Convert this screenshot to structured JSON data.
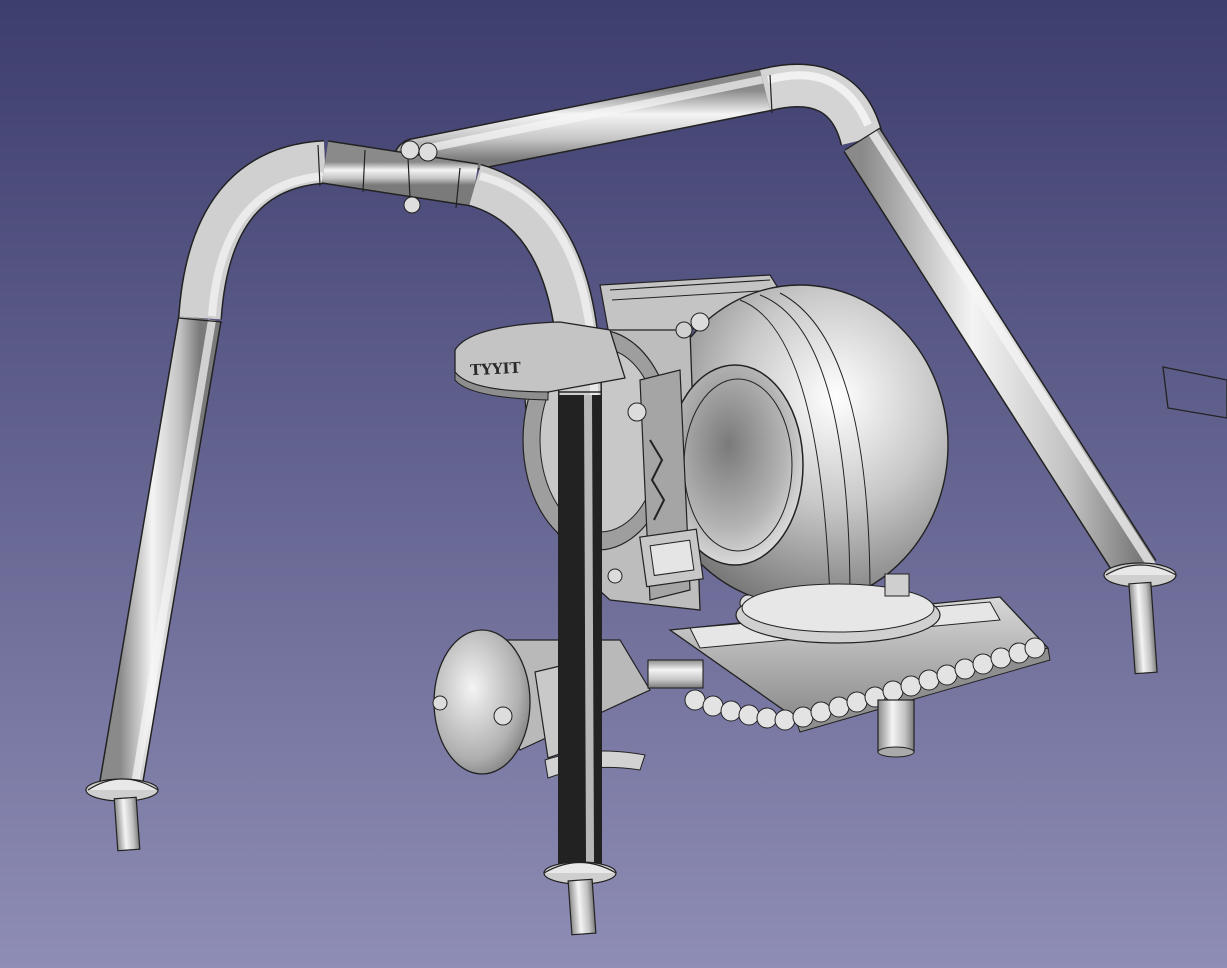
{
  "app": {
    "view": "3d-viewport"
  },
  "colors": {
    "bg_top": "#3d3d6e",
    "bg_bottom": "#8e8db5",
    "metal_light": "#f2f2f2",
    "metal_mid": "#b8b8b8",
    "metal_dark": "#6e6e6e",
    "edge": "#1a1a1a"
  },
  "model": {
    "emblem_text": "TYYIT",
    "parts": [
      "roll-bar-front",
      "roll-bar-rear",
      "turbocharger",
      "base-plate",
      "actuator-canister",
      "support-legs"
    ]
  }
}
